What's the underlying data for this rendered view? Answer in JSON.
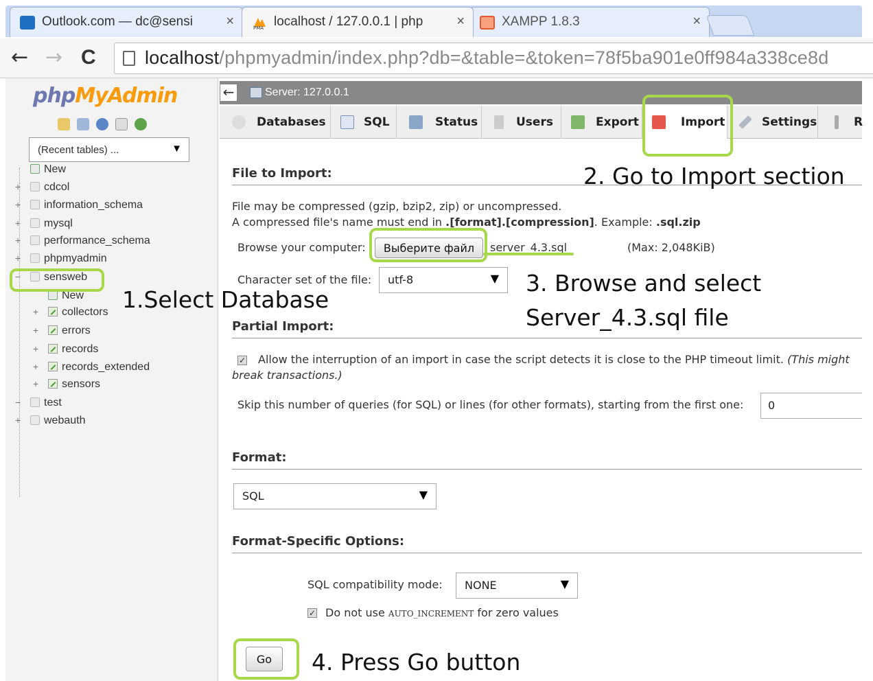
{
  "browser": {
    "tabs": [
      {
        "title": "Outlook.com — dc@sensi",
        "close": "×"
      },
      {
        "title": "localhost / 127.0.0.1 | php",
        "close": "×"
      },
      {
        "title": "XAMPP 1.8.3",
        "close": "×"
      }
    ],
    "nav": {
      "back": "←",
      "forward": "→",
      "reload": "C"
    },
    "url": {
      "host": "localhost",
      "path": "/phpmyadmin/index.php?db=&table=&token=78f5ba901e0ff984a338ce8d"
    }
  },
  "sidebar": {
    "logo": {
      "php": "php",
      "my": "MyAdmin"
    },
    "recent_tables": "(Recent tables) ...",
    "databases": [
      {
        "label": "New"
      },
      {
        "label": "cdcol"
      },
      {
        "label": "information_schema"
      },
      {
        "label": "mysql"
      },
      {
        "label": "performance_schema"
      },
      {
        "label": "phpmyadmin"
      },
      {
        "label": "sensweb"
      },
      {
        "label": "New"
      },
      {
        "label": "collectors"
      },
      {
        "label": "errors"
      },
      {
        "label": "records"
      },
      {
        "label": "records_extended"
      },
      {
        "label": "sensors"
      },
      {
        "label": "test"
      },
      {
        "label": "webauth"
      }
    ]
  },
  "server_bar": {
    "collapse": "←",
    "label": "Server: 127.0.0.1"
  },
  "menu": {
    "tabs": [
      "Databases",
      "SQL",
      "Status",
      "Users",
      "Export",
      "Import",
      "Settings",
      "R"
    ],
    "active": "Import"
  },
  "import": {
    "file_heading": "File to Import:",
    "compressed_note": "File may be compressed (gzip, bzip2, zip) or uncompressed.",
    "name_note_prefix": "A compressed file's name must end in",
    "name_note_format": ".[format].[compression]",
    "name_note_example": ". Example:",
    "name_note_ext": ".sql.zip",
    "browse_label": "Browse your computer:",
    "browse_button": "Выберите файл",
    "chosen_file": "server_4.3.sql",
    "max_size": "(Max: 2,048KiB)",
    "charset_label": "Character set of the file:",
    "charset_value": "utf-8",
    "partial_heading": "Partial Import:",
    "allow_interrupt": "Allow the interruption of an import in case the script detects it is close to the PHP timeout limit.",
    "allow_interrupt_note_1": "(This might",
    "allow_interrupt_note_2": "break transactions.)",
    "skip_label": "Skip this number of queries (for SQL) or lines (for other formats), starting from the first one:",
    "skip_value": "0",
    "format_heading": "Format:",
    "format_value": "SQL",
    "options_heading": "Format-Specific Options:",
    "compat_label": "SQL compatibility mode:",
    "compat_value": "NONE",
    "auto_inc_prefix": "Do not use",
    "auto_inc_code": "AUTO_INCREMENT",
    "auto_inc_suffix": "for zero values",
    "go_button": "Go"
  },
  "annotations": {
    "step1": "1.Select Database",
    "step2": "2. Go to Import section",
    "step3_line1": "3. Browse and select",
    "step3_line2": "Server_4.3.sql file",
    "step4": "4. Press Go button",
    "highlight_color": "#a6d84a"
  }
}
